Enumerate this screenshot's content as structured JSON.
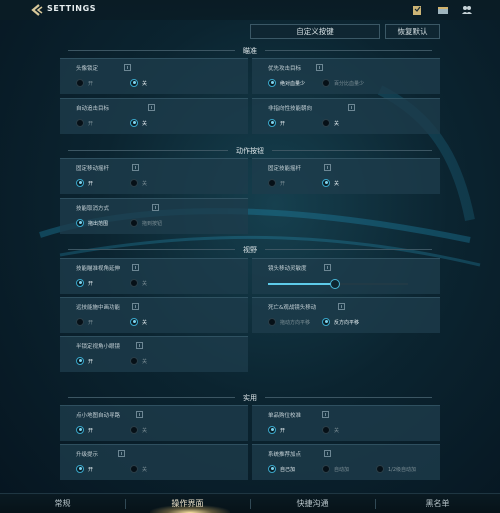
{
  "header": {
    "title": "SETTINGS",
    "icons": [
      "back-icon",
      "mission-icon",
      "shop-icon",
      "friends-icon"
    ]
  },
  "actions": {
    "custom_keys": "自定义按键",
    "restore_default": "恢复默认"
  },
  "sections": {
    "aim": {
      "title": "瞄准",
      "lock_head": {
        "label": "头像锁定",
        "on": "开",
        "off": "关",
        "selected": "off"
      },
      "priority_target": {
        "label": "优先攻击目标",
        "opt1": "绝对血量少",
        "opt2": "百分比血量少",
        "selected": "opt1"
      },
      "auto_chase": {
        "label": "自动追击目标",
        "on": "开",
        "off": "关",
        "selected": "off"
      },
      "non_direction": {
        "label": "非指向性技能朝向",
        "on": "开",
        "off": "关",
        "selected": "on"
      }
    },
    "action_buttons": {
      "title": "动作按钮",
      "fixed_joystick": {
        "label": "固定移动摇杆",
        "on": "开",
        "off": "关",
        "selected": "on"
      },
      "fixed_skill_joystick": {
        "label": "固定技能摇杆",
        "on": "开",
        "off": "关",
        "selected": "off"
      },
      "cancel_mode": {
        "label": "技能取消方式",
        "opt1": "拖出范围",
        "opt2": "拖到按钮",
        "selected": "opt1"
      }
    },
    "view": {
      "title": "视野",
      "skill_lens_delay": {
        "label": "技能瞄准视角延伸",
        "on": "开",
        "off": "关",
        "selected": "on"
      },
      "camera_sensitivity": {
        "label": "镜头移动灵敏度",
        "value_pct": 48
      },
      "remote_skill": {
        "label": "远技能施中画功能",
        "on": "开",
        "off": "关",
        "selected": "off"
      },
      "death_camera": {
        "label": "死亡&观战镜头移动",
        "opt1": "拖动方向平移",
        "opt2": "反方向平移",
        "selected": "opt2"
      },
      "half_lock_view": {
        "label": "半锁定视角小眼镜",
        "on": "开",
        "off": "关",
        "selected": "on"
      }
    },
    "practical": {
      "title": "实用",
      "minimap_path": {
        "label": "点小地图自动寻路",
        "on": "开",
        "off": "关",
        "selected": "on"
      },
      "single_item_check": {
        "label": "单品购位校准",
        "on": "开",
        "off": "关",
        "selected": "on"
      },
      "upgrade_hint": {
        "label": "升级提示",
        "on": "开",
        "off": "关",
        "selected": "on"
      },
      "auto_skill_points": {
        "label": "系统推荐加点",
        "opt1": "自己加",
        "opt2": "自动加",
        "opt3": "1/2级自动加",
        "selected": "opt1"
      }
    }
  },
  "tabs": {
    "tab1": "常规",
    "tab2": "操作界面",
    "tab3": "快捷沟通",
    "tab4": "黑名单",
    "active": "tab2"
  },
  "colors": {
    "accent": "#3aa6c9",
    "background": "#0b2430",
    "card": "#1e3c4b"
  }
}
